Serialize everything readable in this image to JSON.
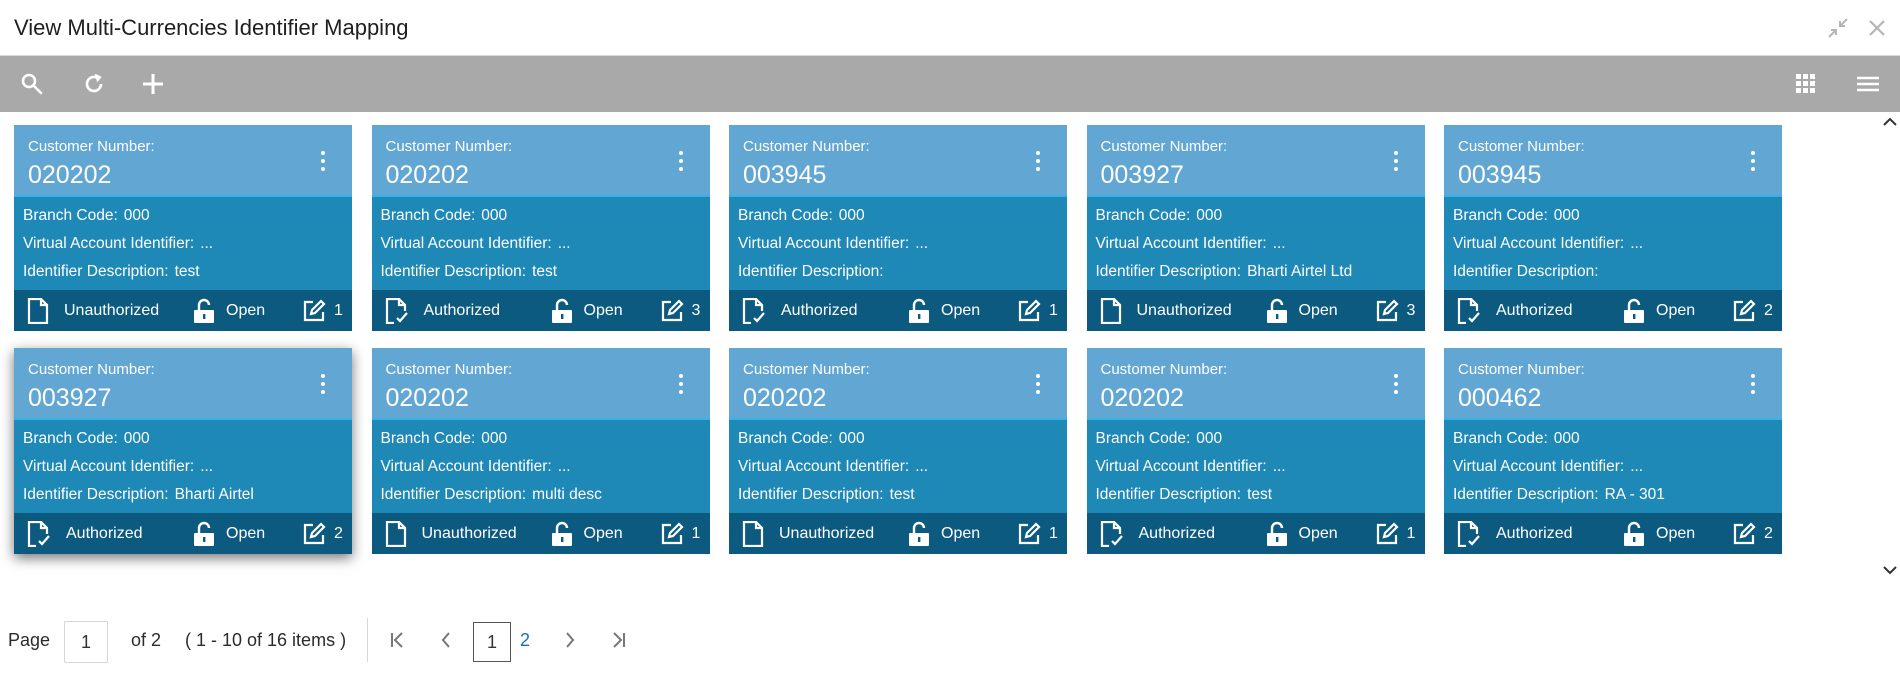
{
  "window": {
    "title": "View Multi-Currencies Identifier Mapping"
  },
  "labels": {
    "customer_number": "Customer Number:",
    "branch_code": "Branch Code:",
    "virtual_account": "Virtual Account Identifier:",
    "identifier_description": "Identifier Description:"
  },
  "cards": [
    {
      "customer_number": "020202",
      "branch_code": "000",
      "virtual_account": "...",
      "identifier_description": "test",
      "auth_status": "Unauthorized",
      "record_status": "Open",
      "modifications": "1"
    },
    {
      "customer_number": "020202",
      "branch_code": "000",
      "virtual_account": "...",
      "identifier_description": "test",
      "auth_status": "Authorized",
      "record_status": "Open",
      "modifications": "3"
    },
    {
      "customer_number": "003945",
      "branch_code": "000",
      "virtual_account": "...",
      "identifier_description": "",
      "auth_status": "Authorized",
      "record_status": "Open",
      "modifications": "1"
    },
    {
      "customer_number": "003927",
      "branch_code": "000",
      "virtual_account": "...",
      "identifier_description": "Bharti Airtel Ltd",
      "auth_status": "Unauthorized",
      "record_status": "Open",
      "modifications": "3"
    },
    {
      "customer_number": "003945",
      "branch_code": "000",
      "virtual_account": "...",
      "identifier_description": "",
      "auth_status": "Authorized",
      "record_status": "Open",
      "modifications": "2"
    },
    {
      "customer_number": "003927",
      "branch_code": "000",
      "virtual_account": "...",
      "identifier_description": "Bharti Airtel",
      "auth_status": "Authorized",
      "record_status": "Open",
      "modifications": "2"
    },
    {
      "customer_number": "020202",
      "branch_code": "000",
      "virtual_account": "...",
      "identifier_description": "multi desc",
      "auth_status": "Unauthorized",
      "record_status": "Open",
      "modifications": "1"
    },
    {
      "customer_number": "020202",
      "branch_code": "000",
      "virtual_account": "...",
      "identifier_description": "test",
      "auth_status": "Unauthorized",
      "record_status": "Open",
      "modifications": "1"
    },
    {
      "customer_number": "020202",
      "branch_code": "000",
      "virtual_account": "...",
      "identifier_description": "test",
      "auth_status": "Authorized",
      "record_status": "Open",
      "modifications": "1"
    },
    {
      "customer_number": "000462",
      "branch_code": "000",
      "virtual_account": "...",
      "identifier_description": "RA - 301",
      "auth_status": "Authorized",
      "record_status": "Open",
      "modifications": "2"
    }
  ],
  "pagination": {
    "page_label": "Page",
    "current_page": "1",
    "of_label": "of 2",
    "items_summary": "( 1 - 10 of 16 items )",
    "pages": [
      "1",
      "2"
    ]
  },
  "icons": {
    "window": [
      "minimize-icon",
      "close-icon"
    ],
    "toolbar": [
      "search-icon",
      "refresh-icon",
      "add-icon",
      "tile-view-icon",
      "list-view-icon"
    ],
    "card": [
      "kebab-menu-icon",
      "unauthorized-doc-icon",
      "authorized-doc-icon",
      "open-lock-icon",
      "edit-icon"
    ],
    "pagination": [
      "first-page-icon",
      "prev-page-icon",
      "next-page-icon",
      "last-page-icon"
    ]
  },
  "colors": {
    "toolbar_bg": "#a9a9a9",
    "card_header": "#62a6d4",
    "card_body": "#1e88b6",
    "card_footer": "#0d5a80",
    "link": "#1e6fb8"
  }
}
